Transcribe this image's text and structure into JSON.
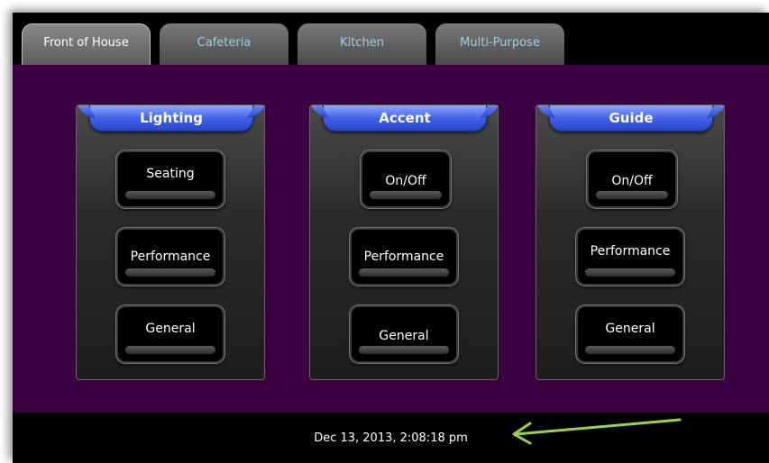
{
  "tabs": [
    {
      "label": "Front of House",
      "active": true
    },
    {
      "label": "Cafeteria",
      "active": false
    },
    {
      "label": "Kitchen",
      "active": false
    },
    {
      "label": "Multi-Purpose",
      "active": false
    }
  ],
  "groups": [
    {
      "title": "Lighting",
      "buttons": [
        "Seating",
        "Performance",
        "General"
      ]
    },
    {
      "title": "Accent",
      "buttons": [
        "On/Off",
        "Performance",
        "General"
      ]
    },
    {
      "title": "Guide",
      "buttons": [
        "On/Off",
        "Performance",
        "General"
      ]
    }
  ],
  "status": {
    "datetime": "Dec 13, 2013, 2:08:18 pm"
  },
  "colors": {
    "panel_bg": "#3a0040",
    "header_blue": "#3d5ee8",
    "annotation_arrow": "#9ad14b"
  }
}
